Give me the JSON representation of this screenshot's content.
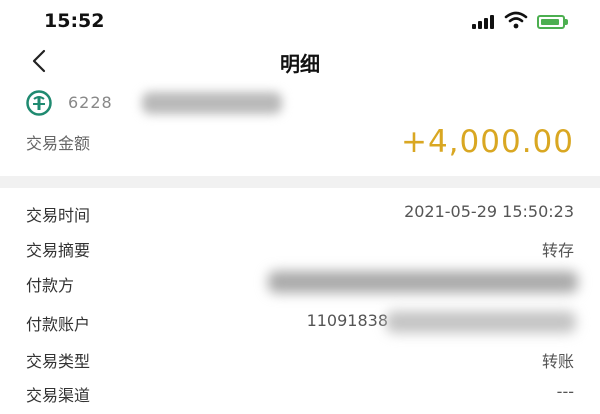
{
  "status_bar": {
    "time": "15:52",
    "signal_icon": "signal-bars-icon",
    "wifi_icon": "wifi-icon",
    "battery_icon": "battery-charging-icon",
    "battery_color": "#4caf50"
  },
  "nav": {
    "back_icon": "chevron-left-icon",
    "title": "明细"
  },
  "account": {
    "bank_logo_icon": "bank-logo-icon",
    "logo_color": "#1f8a70",
    "number_visible_prefix": "6228"
  },
  "amount": {
    "label": "交易金额",
    "value": "+4,000.00",
    "color": "#d9a722"
  },
  "details": [
    {
      "label": "交易时间",
      "value": "2021-05-29 15:50:23"
    },
    {
      "label": "交易摘要",
      "value": "转存"
    },
    {
      "label": "付款方",
      "value": ""
    },
    {
      "label": "付款账户",
      "value": "11091838"
    },
    {
      "label": "交易类型",
      "value": "转账"
    },
    {
      "label": "交易渠道",
      "value": "---"
    }
  ]
}
